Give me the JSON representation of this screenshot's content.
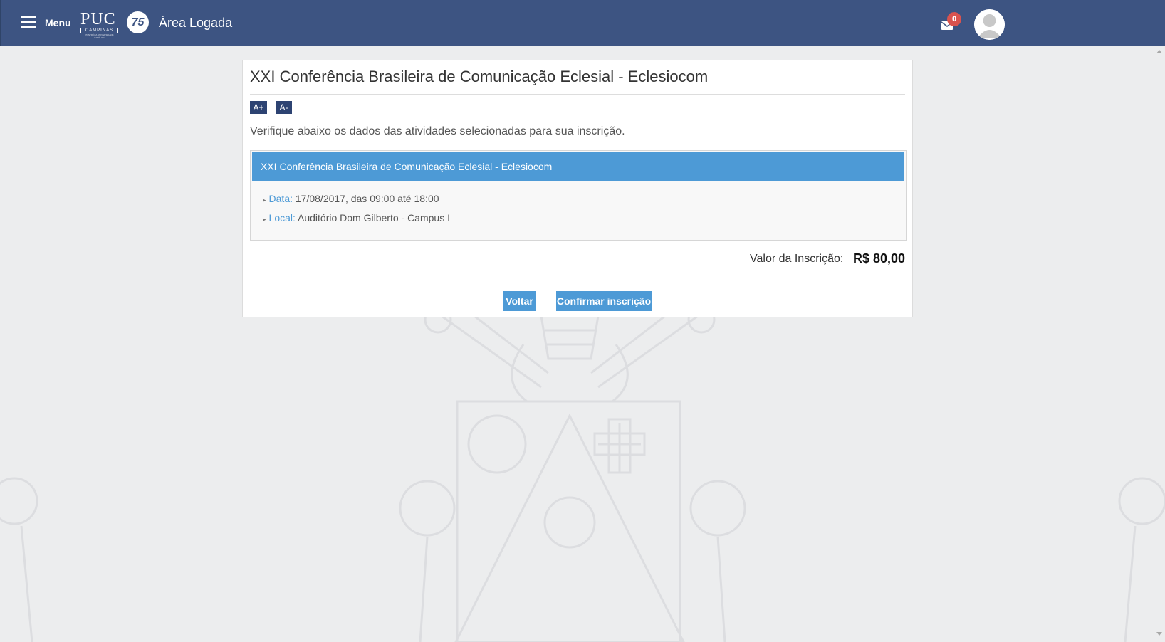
{
  "header": {
    "menu_label": "Menu",
    "logo": {
      "word": "PUC",
      "subtitle": "CAMPINAS",
      "tagline": "PONTIFÍCIA UNIVERSIDADE CATÓLICA"
    },
    "anniversary_badge": "75",
    "area_title": "Área Logada",
    "notifications_count": "0",
    "icons": {
      "menu": "hamburger-icon",
      "mail": "envelope-icon",
      "avatar": "user-avatar-icon"
    }
  },
  "event": {
    "title": "XXI Conferência Brasileira de Comunicação Eclesial - Eclesiocom",
    "font_increase": "A+",
    "font_decrease": "A-",
    "intro": "Verifique abaixo os dados das atividades selecionadas para sua inscrição.",
    "activity": {
      "name": "XXI Conferência Brasileira de Comunicação Eclesial - Eclesiocom",
      "date_label": "Data:",
      "date_value": "17/08/2017, das 09:00 até 18:00",
      "local_label": "Local:",
      "local_value": "Auditório Dom Gilberto - Campus I"
    },
    "fee_label": "Valor da Inscrição:",
    "fee_value": "R$ 80,00",
    "back_button": "Voltar",
    "confirm_button": "Confirmar inscrição"
  },
  "colors": {
    "header_bg": "#3d5482",
    "accent": "#4d9ad6",
    "font_button_bg": "#2d4372",
    "badge": "#d9534f",
    "page_bg": "#ecedee"
  }
}
